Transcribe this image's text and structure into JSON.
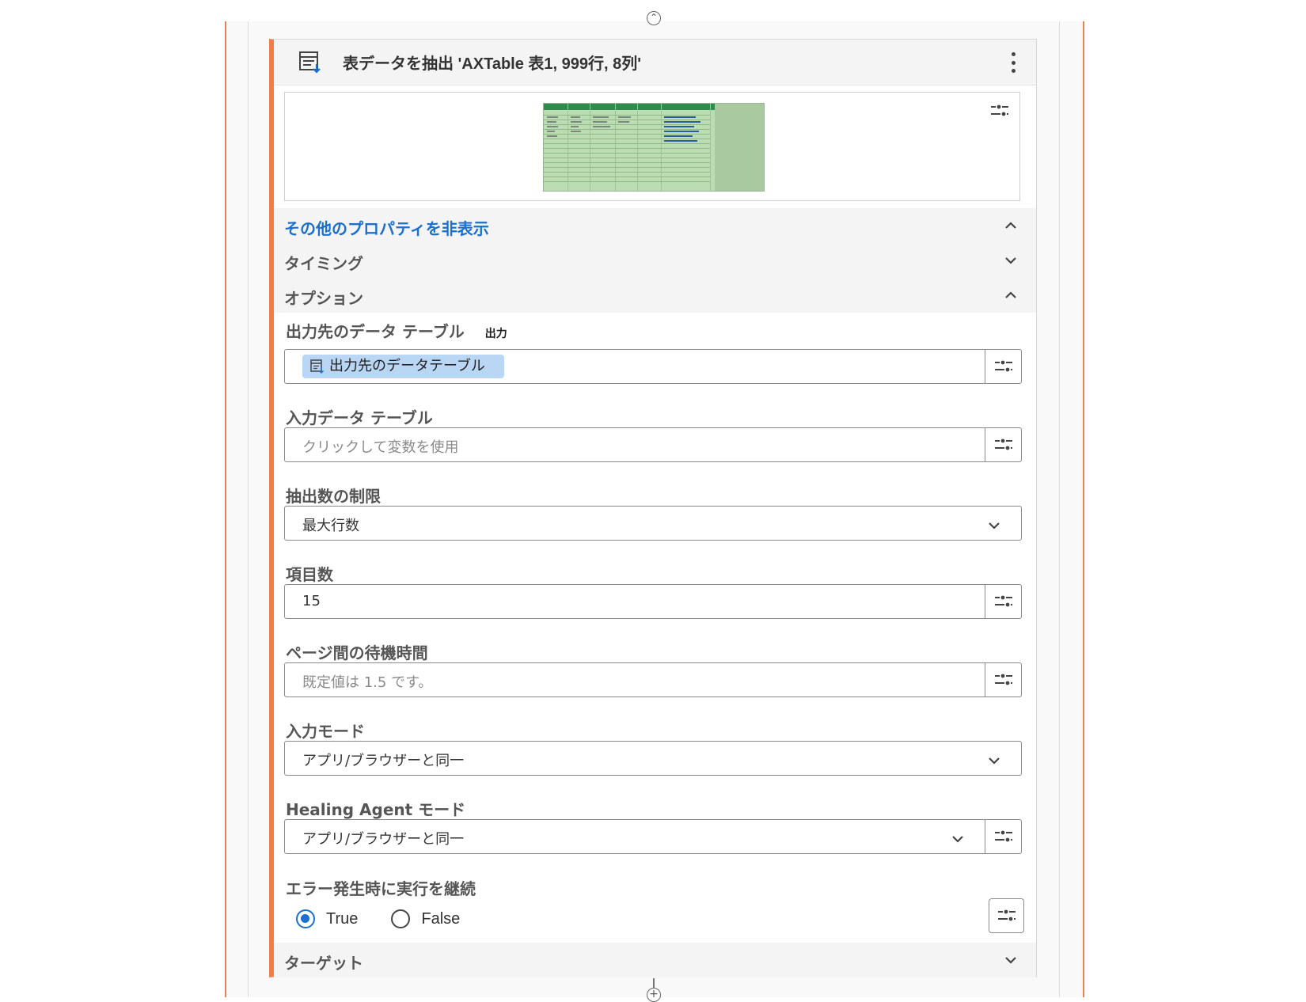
{
  "action": {
    "title": "表データを抽出 'AXTable 表1, 999行, 8列'"
  },
  "sections": {
    "more_props": "その他のプロパティを非表示",
    "timing": "タイミング",
    "options": "オプション",
    "target": "ターゲット"
  },
  "fields": {
    "output_table": {
      "label": "出力先のデータ テーブル",
      "tag": "出力",
      "chip": "出力先のデータテーブル"
    },
    "input_table": {
      "label": "入力データ テーブル",
      "placeholder": "クリックして変数を使用"
    },
    "limit": {
      "label": "抽出数の制限",
      "value": "最大行数"
    },
    "item_count": {
      "label": "項目数",
      "value": "15"
    },
    "page_wait": {
      "label": "ページ間の待機時間",
      "placeholder": "既定値は 1.5 です。"
    },
    "input_mode": {
      "label": "入力モード",
      "value": "アプリ/ブラウザーと同一"
    },
    "healing_mode": {
      "label": "Healing Agent モード",
      "value": "アプリ/ブラウザーと同一"
    },
    "continue_on_error": {
      "label": "エラー発生時に実行を継続",
      "options": [
        "True",
        "False"
      ],
      "selected": "True"
    }
  },
  "colors": {
    "accent": "#f07d4a",
    "link": "#1a6fd0",
    "chip": "#b9d6f5"
  },
  "icons": {
    "header": "extract-table-icon",
    "more": "kebab-menu-icon",
    "variable": "variable-settings-icon"
  }
}
